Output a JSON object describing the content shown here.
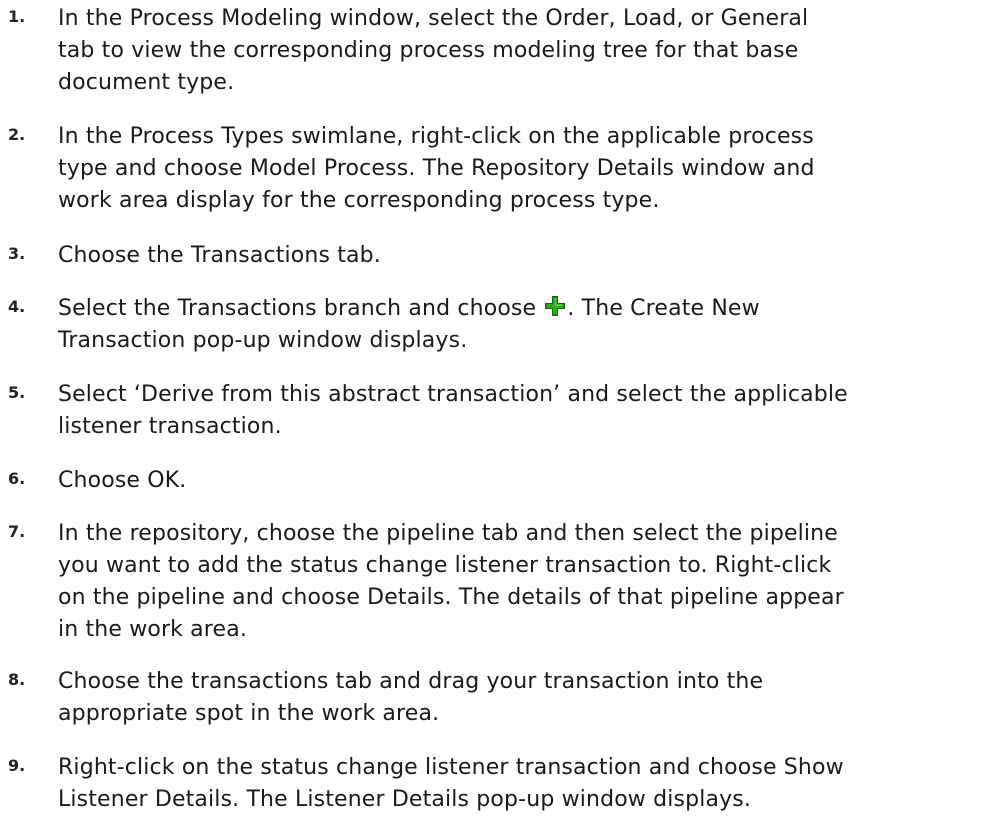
{
  "steps": [
    {
      "number": "1.",
      "lines": [
        "In the Process Modeling window, select the Order, Load, or General",
        "tab to view the corresponding process modeling tree for that base",
        "document type."
      ]
    },
    {
      "number": "2.",
      "lines": [
        "In the Process Types swimlane, right-click on the applicable process",
        "type and choose Model Process. The Repository Details window and",
        "work area display for the corresponding process type."
      ]
    },
    {
      "number": "3.",
      "lines": [
        "Choose the Transactions tab."
      ]
    },
    {
      "number": "4.",
      "line1_before_icon": "Select the Transactions branch and choose ",
      "line1_after_icon": ". The Create New",
      "line2": "Transaction pop-up window displays.",
      "icon": "green-plus-icon"
    },
    {
      "number": "5.",
      "lines": [
        "Select ‘Derive from this abstract transaction’ and select the applicable",
        "listener transaction."
      ]
    },
    {
      "number": "6.",
      "lines": [
        "Choose OK."
      ]
    },
    {
      "number": "7.",
      "lines": [
        "In the repository, choose the pipeline tab and then select the pipeline",
        "you want to add the status change listener transaction to. Right-click",
        "on the pipeline and choose Details. The details of that pipeline appear",
        "in the work area."
      ]
    },
    {
      "number": "8.",
      "lines": [
        "Choose the transactions tab and drag your transaction into the",
        "appropriate spot in the work area."
      ]
    },
    {
      "number": "9.",
      "lines": [
        "Right-click on the status change listener transaction and choose Show",
        "Listener Details. The Listener Details pop-up window displays."
      ]
    }
  ],
  "colors": {
    "text": "#1a1a1a",
    "icon_green": "#2fa81f",
    "icon_green_dark": "#0f6b0a"
  }
}
